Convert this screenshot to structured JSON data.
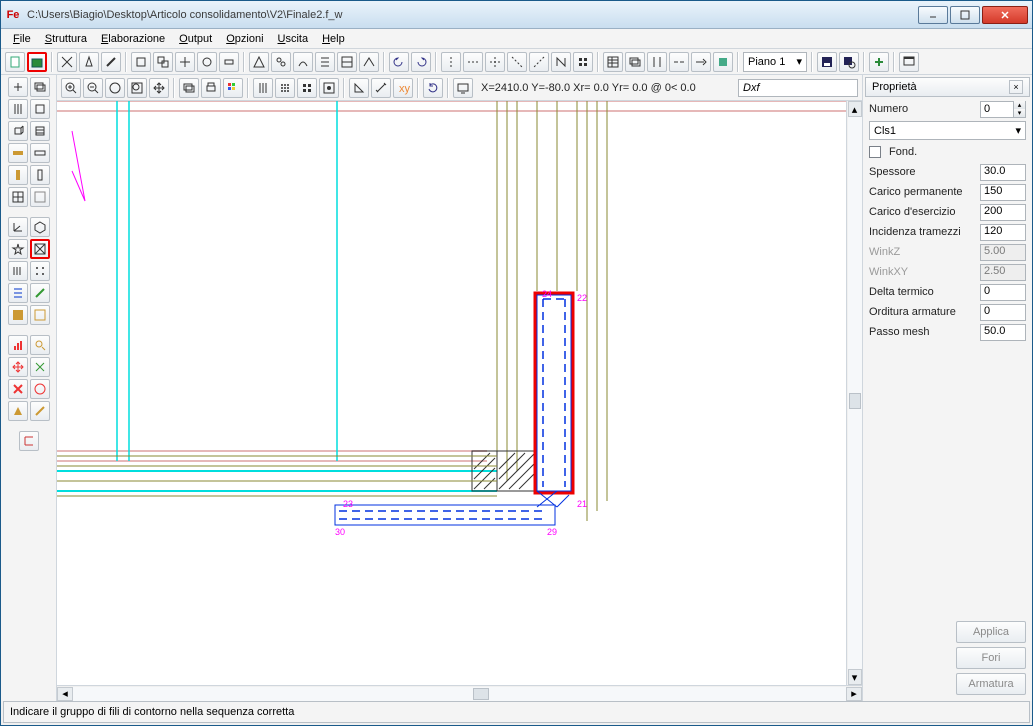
{
  "window": {
    "title": "C:\\Users\\Biagio\\Desktop\\Articolo consolidamento\\V2\\Finale2.f_w",
    "app_icon": "Fe"
  },
  "menu": [
    "File",
    "Struttura",
    "Elaborazione",
    "Output",
    "Opzioni",
    "Uscita",
    "Help"
  ],
  "floor_dropdown": "Piano 1",
  "coord_readout": "X=2410.0 Y=-80.0 Xr=  0.0 Yr=  0.0 @  0<  0.0",
  "dxf_label": "Dxf",
  "properties": {
    "title": "Proprietà",
    "numero_label": "Numero",
    "numero_value": "0",
    "material": "Cls1",
    "fond_label": "Fond.",
    "rows": [
      {
        "label": "Spessore",
        "value": "30.0",
        "disabled": false
      },
      {
        "label": "Carico permanente",
        "value": "150",
        "disabled": false
      },
      {
        "label": "Carico d'esercizio",
        "value": "200",
        "disabled": false
      },
      {
        "label": "Incidenza tramezzi",
        "value": "120",
        "disabled": false
      },
      {
        "label": "WinkZ",
        "value": "5.00",
        "disabled": true
      },
      {
        "label": "WinkXY",
        "value": "2.50",
        "disabled": true
      },
      {
        "label": "Delta termico",
        "value": "0",
        "disabled": false
      },
      {
        "label": "Orditura armature",
        "value": "0",
        "disabled": false
      },
      {
        "label": "Passo mesh",
        "value": "50.0",
        "disabled": false
      }
    ],
    "buttons": [
      "Applica",
      "Fori",
      "Armatura"
    ]
  },
  "statusbar": "Indicare il gruppo di fili di contorno nella sequenza corretta",
  "canvas_annotations": {
    "n22": "22",
    "n21": "21",
    "n29": "29",
    "n30": "30",
    "n23": "23",
    "n24": "24"
  }
}
